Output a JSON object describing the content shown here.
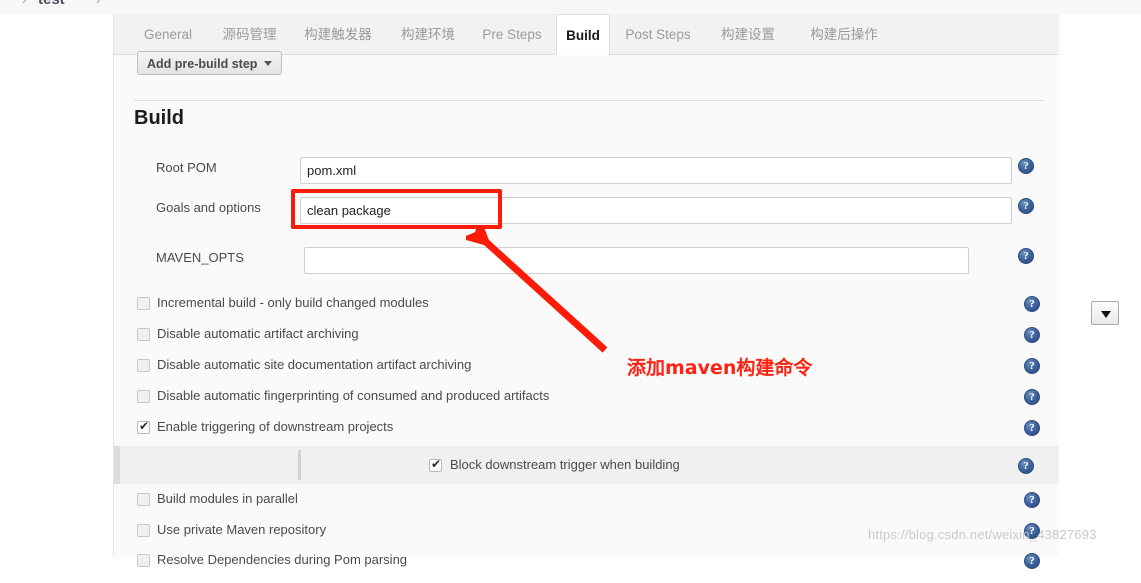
{
  "breadcrumb": {
    "project_name": "test",
    "separator_left": "›",
    "separator_right": "›"
  },
  "tabs": [
    {
      "label": "General",
      "active": false
    },
    {
      "label": "源码管理",
      "active": false
    },
    {
      "label": "构建触发器",
      "active": false
    },
    {
      "label": "构建环境",
      "active": false
    },
    {
      "label": "Pre Steps",
      "active": false
    },
    {
      "label": "Build",
      "active": true
    },
    {
      "label": "Post Steps",
      "active": false
    },
    {
      "label": "构建设置",
      "active": false
    },
    {
      "label": "构建后操作",
      "active": false
    }
  ],
  "prebuild": {
    "button_label": "Add pre-build step"
  },
  "build_section": {
    "heading": "Build",
    "fields": [
      {
        "label": "Root POM",
        "value": "pom.xml",
        "placeholder": "",
        "help": "?"
      },
      {
        "label": "Goals and options",
        "value": "clean package",
        "placeholder": "",
        "help": "?"
      },
      {
        "label": "MAVEN_OPTS",
        "value": "",
        "placeholder": "",
        "help": "?"
      }
    ],
    "dropdown_icon": "dropdown-triangle-icon"
  },
  "checkboxes": [
    {
      "label": "Incremental build - only build changed modules",
      "checked": false,
      "help": "?"
    },
    {
      "label": "Disable automatic artifact archiving",
      "checked": false,
      "help": "?"
    },
    {
      "label": "Disable automatic site documentation artifact archiving",
      "checked": false,
      "help": "?"
    },
    {
      "label": "Disable automatic fingerprinting of consumed and produced artifacts",
      "checked": false,
      "help": "?"
    },
    {
      "label": "Enable triggering of downstream projects",
      "checked": true,
      "help": "?"
    }
  ],
  "nested_checkbox": {
    "label": "Block downstream trigger when building",
    "checked": true,
    "help": "?"
  },
  "checkboxes_bottom": [
    {
      "label": "Build modules in parallel",
      "checked": false,
      "help": "?"
    },
    {
      "label": "Use private Maven repository",
      "checked": false,
      "help": "?"
    },
    {
      "label": "Resolve Dependencies during Pom parsing",
      "checked": false,
      "help": "?"
    }
  ],
  "annotation": {
    "text": "添加maven构建命令",
    "color": "#fc2314",
    "box_color": "#fc1b06",
    "arrow_name": "red-pointer-arrow"
  },
  "watermark": {
    "text": "https://blog.csdn.net/weixin_43827693"
  }
}
